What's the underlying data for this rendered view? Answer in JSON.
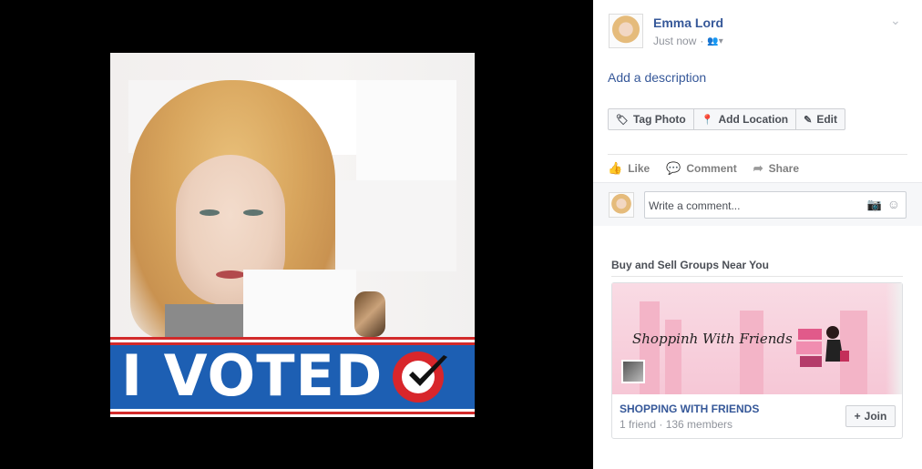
{
  "post": {
    "author": "Emma Lord",
    "time": "Just now",
    "audience_icon": "friends-icon",
    "description_link": "Add a description",
    "photo_text": "I VOTED"
  },
  "toolbar": {
    "tag_photo": "Tag Photo",
    "add_location": "Add Location",
    "edit": "Edit"
  },
  "actions": {
    "like": "Like",
    "comment": "Comment",
    "share": "Share"
  },
  "comment": {
    "placeholder": "Write a comment..."
  },
  "suggestions": {
    "title": "Buy and Sell Groups Near You",
    "group": {
      "cover_text": "Shoppinh With Friends",
      "name": "SHOPPING WITH FRIENDS",
      "meta": "1 friend · 136 members",
      "join_label": "Join"
    }
  },
  "colors": {
    "link": "#365899",
    "banner_blue": "#1d5fb3",
    "banner_red": "#d22a2a"
  }
}
